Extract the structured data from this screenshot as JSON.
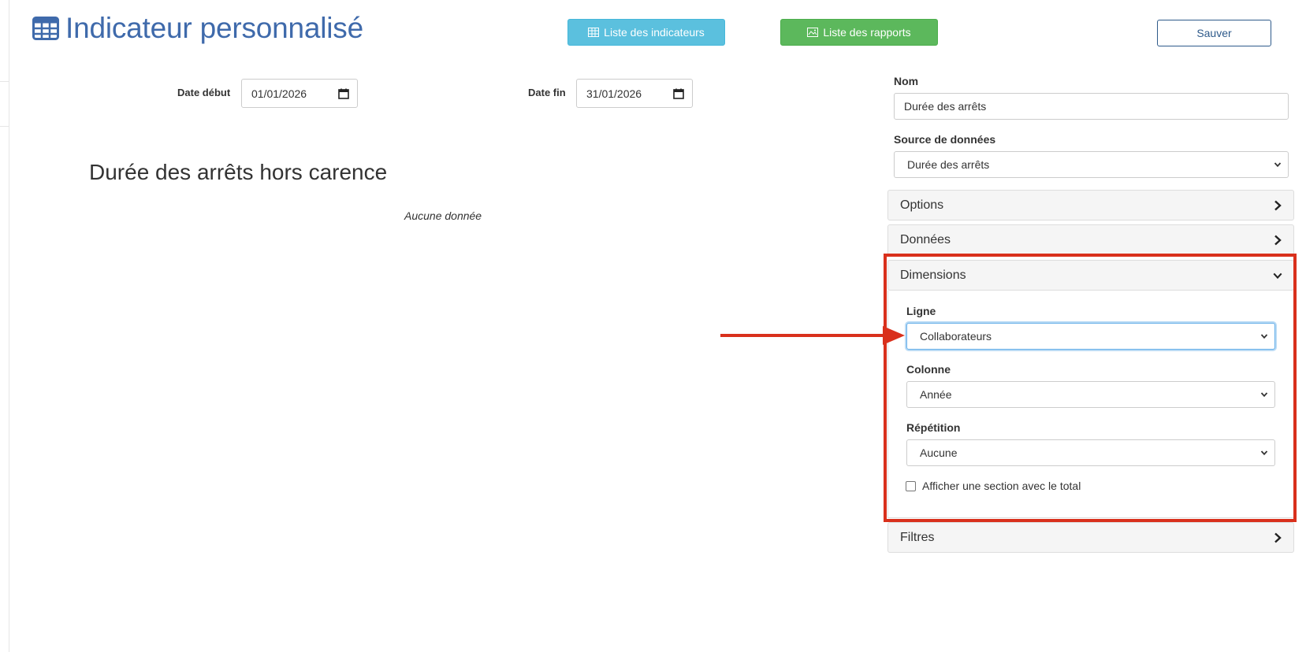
{
  "header": {
    "title": "Indicateur personnalisé",
    "btn_indicateurs": "Liste des indicateurs",
    "btn_rapports": "Liste des rapports",
    "btn_sauver": "Sauver"
  },
  "dates": {
    "start_label": "Date début",
    "start_value": "01/01/2026",
    "end_label": "Date fin",
    "end_value": "31/01/2026"
  },
  "chart": {
    "title": "Durée des arrêts hors carence",
    "empty_text": "Aucune donnée"
  },
  "form": {
    "nom_label": "Nom",
    "nom_value": "Durée des arrêts",
    "source_label": "Source de données",
    "source_value": "Durée des arrêts"
  },
  "panels": {
    "options": "Options",
    "donnees": "Données",
    "dimensions": "Dimensions",
    "filtres": "Filtres"
  },
  "dimensions": {
    "ligne_label": "Ligne",
    "ligne_value": "Collaborateurs",
    "colonne_label": "Colonne",
    "colonne_value": "Année",
    "repetition_label": "Répétition",
    "repetition_value": "Aucune",
    "total_checkbox_label": "Afficher une section avec le total",
    "total_checked": false
  },
  "colors": {
    "title_blue": "#3f6aab",
    "info_button": "#5bc0de",
    "success_button": "#5cb85c",
    "annotation_red": "#d9301c"
  },
  "icons": {
    "title": "table-icon",
    "indicateurs": "table-icon",
    "rapports": "image-icon",
    "collapsed": "chevron-right-icon",
    "expanded": "chevron-down-icon",
    "date": "calendar-icon",
    "annotation": "arrow-right-icon"
  }
}
